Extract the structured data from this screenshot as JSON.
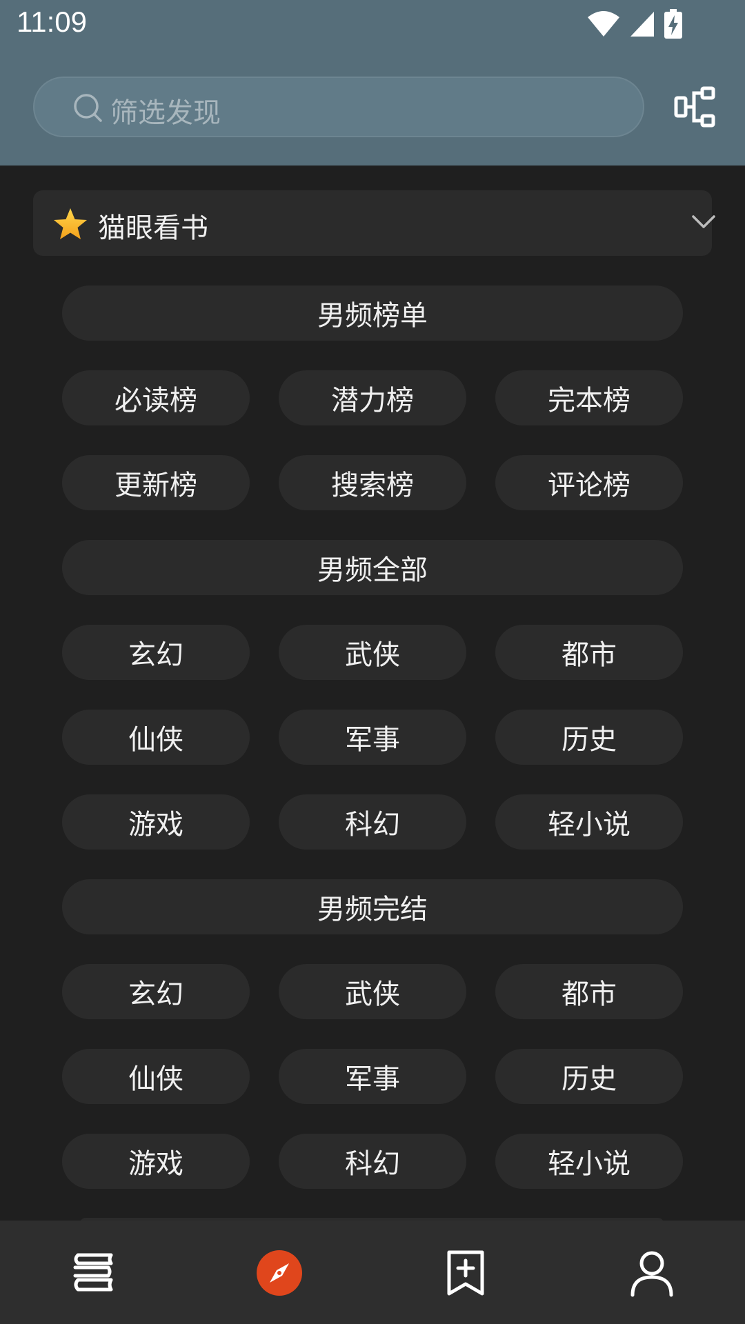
{
  "status_bar": {
    "time": "11:09"
  },
  "search": {
    "placeholder": "筛选发现"
  },
  "source_selector": {
    "label": "猫眼看书"
  },
  "sections": [
    {
      "title": "男频榜单",
      "items": [
        "必读榜",
        "潜力榜",
        "完本榜",
        "更新榜",
        "搜索榜",
        "评论榜"
      ]
    },
    {
      "title": "男频全部",
      "items": [
        "玄幻",
        "武侠",
        "都市",
        "仙侠",
        "军事",
        "历史",
        "游戏",
        "科幻",
        "轻小说"
      ]
    },
    {
      "title": "男频完结",
      "items": [
        "玄幻",
        "武侠",
        "都市",
        "仙侠",
        "军事",
        "历史",
        "游戏",
        "科幻",
        "轻小说"
      ]
    }
  ],
  "bottom_nav": [
    {
      "icon": "bookshelf-icon"
    },
    {
      "icon": "discover-compass-icon",
      "active": true
    },
    {
      "icon": "rss-bookmark-add-icon"
    },
    {
      "icon": "profile-icon"
    }
  ],
  "colors": {
    "accent": "#e0461c",
    "header": "#566e7a",
    "background": "#1f1f1f",
    "chip": "#2b2b2b"
  }
}
